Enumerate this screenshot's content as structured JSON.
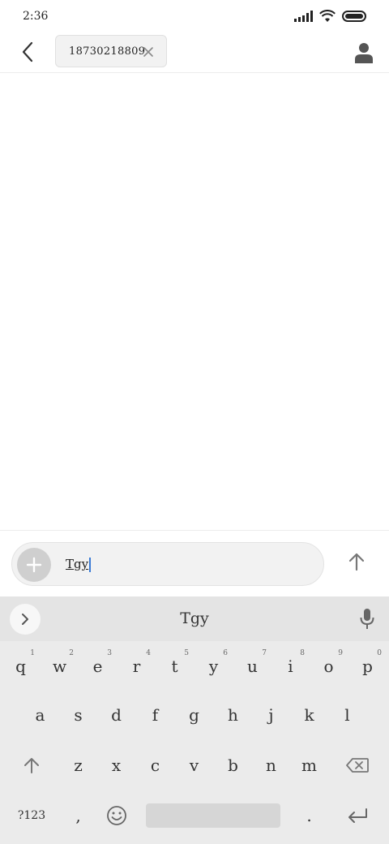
{
  "status": {
    "time": "2:36",
    "icons": [
      "signal-icon",
      "wifi-icon",
      "battery-icon"
    ]
  },
  "header": {
    "back_icon": "back-arrow-icon",
    "recipient": "18730218809",
    "chip_close_icon": "close-icon",
    "contact_icon": "person-icon"
  },
  "composer": {
    "add_icon": "plus-icon",
    "text": "Tgy",
    "send_icon": "arrow-up-icon"
  },
  "keyboard": {
    "suggestion": "Tgy",
    "expand_icon": "chevron-right-icon",
    "mic_icon": "microphone-icon",
    "row1": [
      {
        "label": "q",
        "hint": "1"
      },
      {
        "label": "w",
        "hint": "2"
      },
      {
        "label": "e",
        "hint": "3"
      },
      {
        "label": "r",
        "hint": "4"
      },
      {
        "label": "t",
        "hint": "5"
      },
      {
        "label": "y",
        "hint": "6"
      },
      {
        "label": "u",
        "hint": "7"
      },
      {
        "label": "i",
        "hint": "8"
      },
      {
        "label": "o",
        "hint": "9"
      },
      {
        "label": "p",
        "hint": "0"
      }
    ],
    "row2": [
      "a",
      "s",
      "d",
      "f",
      "g",
      "h",
      "j",
      "k",
      "l"
    ],
    "row3": [
      "z",
      "x",
      "c",
      "v",
      "b",
      "n",
      "m"
    ],
    "shift_icon": "shift-arrow-icon",
    "backspace_icon": "backspace-icon",
    "symbols_label": "?123",
    "comma_label": ",",
    "emoji_icon": "emoji-icon",
    "period_label": ".",
    "enter_icon": "enter-icon"
  },
  "colors": {
    "caret": "#3a7bd5",
    "keyboard_bg": "#ebebeb",
    "suggestion_bg": "#e4e4e4"
  }
}
